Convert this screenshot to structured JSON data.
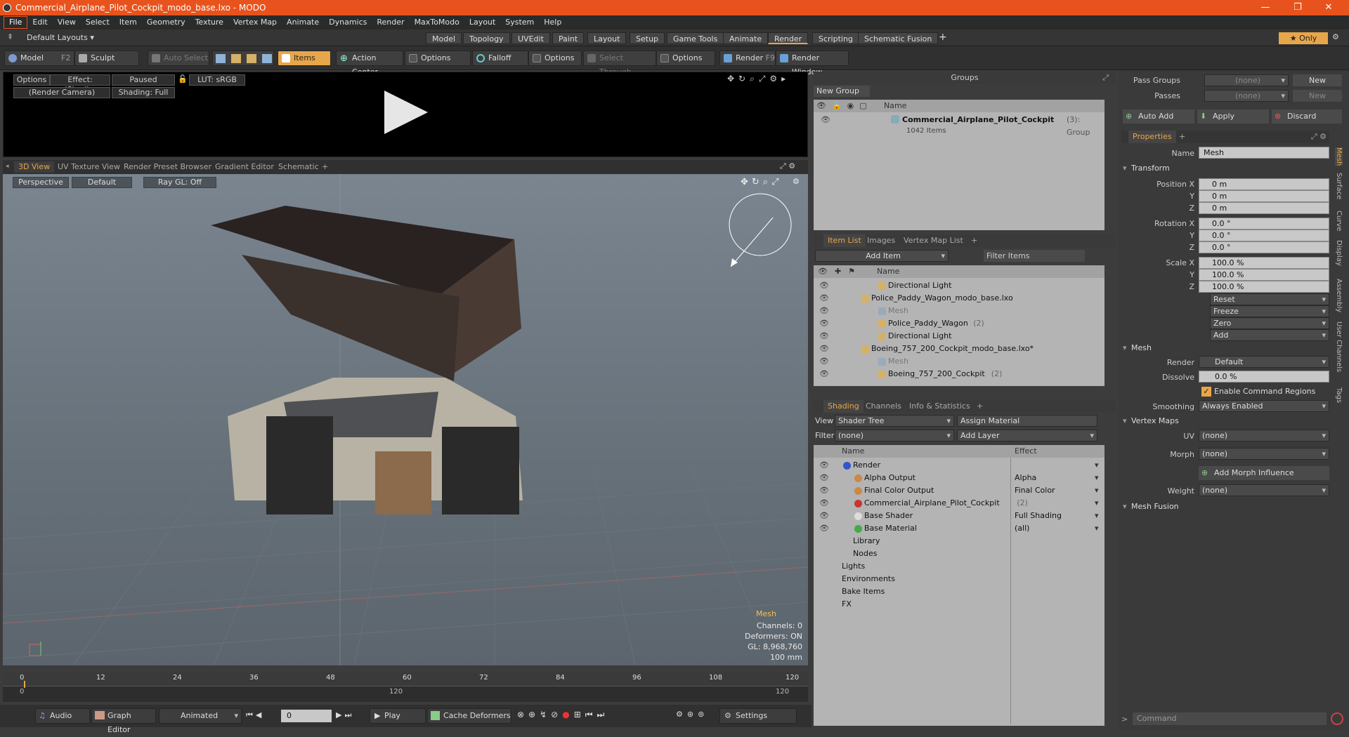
{
  "window": {
    "title": "Commercial_Airplane_Pilot_Cockpit_modo_base.lxo - MODO"
  },
  "menu": [
    "File",
    "Edit",
    "View",
    "Select",
    "Item",
    "Geometry",
    "Texture",
    "Vertex Map",
    "Animate",
    "Dynamics",
    "Render",
    "MaxToModo",
    "Layout",
    "System",
    "Help"
  ],
  "layouts": {
    "default": "Default Layouts",
    "tabs": [
      "Model",
      "Topology",
      "UVEdit",
      "Paint",
      "Layout",
      "Setup",
      "Game Tools",
      "Animate",
      "Render",
      "Scripting",
      "Schematic Fusion"
    ],
    "active": "Render",
    "only": "Only"
  },
  "toolbar": {
    "model": "Model",
    "model_key": "F2",
    "sculpt": "Sculpt",
    "auto_select": "Auto Select",
    "items": "Items",
    "action_center": "Action Center",
    "options1": "Options",
    "falloff": "Falloff",
    "options2": "Options",
    "select_through": "Select Through",
    "options3": "Options",
    "render": "Render",
    "render_key": "F9",
    "render_window": "Render Window"
  },
  "render_preview": {
    "options": "Options",
    "effect": "Effect: (Shadi...",
    "paused": "Paused",
    "lut": "LUT: sRGB",
    "camera": "(Render Camera)",
    "shading": "Shading: Full"
  },
  "viewport_tabs": [
    "3D View",
    "UV Texture View",
    "Render Preset Browser",
    "Gradient Editor",
    "Schematic"
  ],
  "viewport": {
    "perspective": "Perspective",
    "default": "Default",
    "raygl": "Ray GL: Off",
    "info_title": "Mesh",
    "info": [
      "Channels: 0",
      "Deformers: ON",
      "GL: 8,968,760",
      "100 mm"
    ]
  },
  "timeline": {
    "ticks": [
      "0",
      "12",
      "24",
      "36",
      "48",
      "60",
      "72",
      "84",
      "96",
      "108",
      "120"
    ],
    "sub": [
      "0",
      "120",
      "120"
    ]
  },
  "bottom": {
    "audio": "Audio",
    "graph_editor": "Graph Editor",
    "animated": "Animated",
    "frame": "0",
    "play": "Play",
    "cache": "Cache Deformers",
    "settings": "Settings"
  },
  "groups": {
    "title": "Groups",
    "new_group": "New Group",
    "col_name": "Name",
    "item_name": "Commercial_Airplane_Pilot_Cockpit",
    "item_count": "(3)",
    "item_type": ": Group",
    "item_sub": "1042 Items"
  },
  "itemlist": {
    "tabs": [
      "Item List",
      "Images",
      "Vertex Map List"
    ],
    "add_item": "Add Item",
    "filter": "Filter Items",
    "col_name": "Name",
    "rows": [
      {
        "text": "Directional Light",
        "indent": 3,
        "dim": false
      },
      {
        "text": "Police_Paddy_Wagon_modo_base.lxo",
        "indent": 1,
        "dim": false
      },
      {
        "text": "Mesh",
        "indent": 3,
        "dim": true
      },
      {
        "text": "Police_Paddy_Wagon",
        "count": "(2)",
        "indent": 3,
        "dim": false
      },
      {
        "text": "Directional Light",
        "indent": 3,
        "dim": false
      },
      {
        "text": "Boeing_757_200_Cockpit_modo_base.lxo*",
        "indent": 1,
        "dim": false
      },
      {
        "text": "Mesh",
        "indent": 3,
        "dim": true
      },
      {
        "text": "Boeing_757_200_Cockpit",
        "count": "(2)",
        "indent": 3,
        "dim": false
      }
    ]
  },
  "shading": {
    "tabs": [
      "Shading",
      "Channels",
      "Info & Statistics"
    ],
    "view_label": "View",
    "view": "Shader Tree",
    "assign": "Assign Material",
    "filter_label": "Filter",
    "filter": "(none)",
    "add_layer": "Add Layer",
    "col_name": "Name",
    "col_effect": "Effect",
    "rows": [
      {
        "name": "Render",
        "effect": "",
        "indent": 1
      },
      {
        "name": "Alpha Output",
        "effect": "Alpha",
        "indent": 2
      },
      {
        "name": "Final Color Output",
        "effect": "Final Color",
        "indent": 2
      },
      {
        "name": "Commercial_Airplane_Pilot_Cockpit",
        "count": "(2)",
        "effect": "",
        "indent": 2
      },
      {
        "name": "Base Shader",
        "effect": "Full Shading",
        "indent": 2
      },
      {
        "name": "Base Material",
        "effect": "(all)",
        "indent": 2
      },
      {
        "name": "Library",
        "effect": "",
        "indent": 1
      },
      {
        "name": "Nodes",
        "effect": "",
        "indent": 1
      },
      {
        "name": "Lights",
        "effect": "",
        "indent": 0
      },
      {
        "name": "Environments",
        "effect": "",
        "indent": 0
      },
      {
        "name": "Bake Items",
        "effect": "",
        "indent": 0
      },
      {
        "name": "FX",
        "effect": "",
        "indent": 0
      }
    ]
  },
  "properties": {
    "pass_groups": "Pass Groups",
    "passes": "Passes",
    "none": "(none)",
    "new": "New",
    "auto_add": "Auto Add",
    "apply": "Apply",
    "discard": "Discard",
    "tab": "Properties",
    "name_label": "Name",
    "name_value": "Mesh",
    "transform": "Transform",
    "position": [
      "Position X",
      "Y",
      "Z"
    ],
    "pos_vals": [
      "0 m",
      "0 m",
      "0 m"
    ],
    "rotation": [
      "Rotation X",
      "Y",
      "Z"
    ],
    "rot_vals": [
      "0.0 °",
      "0.0 °",
      "0.0 °"
    ],
    "scale": [
      "Scale X",
      "Y",
      "Z"
    ],
    "scale_vals": [
      "100.0 %",
      "100.0 %",
      "100.0 %"
    ],
    "actions": [
      "Reset",
      "Freeze",
      "Zero",
      "Add"
    ],
    "mesh": "Mesh",
    "render_label": "Render",
    "render_val": "Default",
    "dissolve_label": "Dissolve",
    "dissolve_val": "0.0 %",
    "enable_cmd": "Enable Command Regions",
    "smoothing_label": "Smoothing",
    "smoothing_val": "Always Enabled",
    "vertex_maps": "Vertex Maps",
    "uv_label": "UV",
    "uv_val": "(none)",
    "morph_label": "Morph",
    "morph_val": "(none)",
    "add_morph": "Add Morph Influence",
    "weight_label": "Weight",
    "weight_val": "(none)",
    "mesh_fusion": "Mesh Fusion",
    "side_tabs": [
      "Mesh",
      "Surface",
      "Curve",
      "Display",
      "Assembly",
      "User Channels",
      "Tags"
    ],
    "command": "Command"
  }
}
